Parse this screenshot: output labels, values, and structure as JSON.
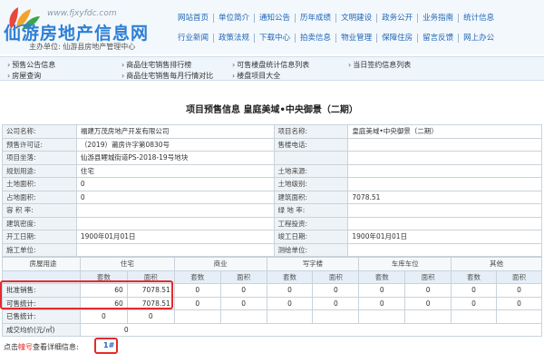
{
  "header": {
    "url": "www.fjxyfdc.com",
    "title": "仙游房地产信息网",
    "sponsor": "主办单位: 仙游县房地产管理中心"
  },
  "topnav": {
    "row1": [
      "网站首页",
      "单位简介",
      "通知公告",
      "历年成绩",
      "文明建设",
      "政务公开",
      "业务指南",
      "统计信息"
    ],
    "row2": [
      "行业新闻",
      "政策法规",
      "下载中心",
      "拍卖信息",
      "物业管理",
      "保障住房",
      "留言反馈",
      "网上办公"
    ]
  },
  "menubar": {
    "items": [
      "预售公告信息",
      "商品住宅销售排行榜",
      "可售楼盘统计信息列表",
      "当日签约信息列表",
      "房屋查询",
      "商品住宅销售每月行情对比",
      "楼盘项目大全"
    ]
  },
  "title": "项目预售信息 皇庭美域•中央御景（二期）",
  "info": {
    "rows": [
      [
        "公司名称:",
        "福建万茂房地产开发有限公司",
        "项目名称:",
        "皇庭美域•中央御景（二期）"
      ],
      [
        "预售许可证:",
        "（2019）莆房许字第0830号",
        "售楼电话:",
        ""
      ],
      [
        "项目坐落:",
        "仙游县鲤城街道PS-2018-19号地块",
        "",
        ""
      ],
      [
        "规划用途:",
        "住宅",
        "土地来源:",
        ""
      ],
      [
        "土地面积:",
        "0",
        "土地级别:",
        ""
      ],
      [
        "占地面积:",
        "0",
        "建筑面积:",
        "7078.51"
      ],
      [
        "容 积 率:",
        "",
        "绿 地 率:",
        ""
      ],
      [
        "建筑密度:",
        "",
        "工程投资:",
        ""
      ],
      [
        "开工日期:",
        "1900年01月01日",
        "竣工日期:",
        "1900年01月01日"
      ],
      [
        "施工单位:",
        "",
        "测绘单位:",
        ""
      ]
    ]
  },
  "stats": {
    "row_label_header": "房屋用途",
    "groups": [
      "住宅",
      "商业",
      "写字楼",
      "车库车位",
      "其他"
    ],
    "sub": [
      "套数",
      "面积"
    ],
    "rows": [
      {
        "label": "批准销售:",
        "values": [
          "60",
          "7078.51",
          "0",
          "0",
          "0",
          "0",
          "0",
          "0",
          "0",
          "0"
        ]
      },
      {
        "label": "可售统计:",
        "values": [
          "60",
          "7078.51",
          "0",
          "0",
          "0",
          "0",
          "0",
          "0",
          "0",
          "0"
        ]
      },
      {
        "label": "已售统计:",
        "values": [
          "0",
          "0",
          "",
          "",
          "",
          "",
          "",
          "",
          "",
          ""
        ]
      },
      {
        "label": "成交均价(元/㎡)",
        "values": [
          "0",
          "",
          "",
          "",
          "",
          "",
          "",
          "",
          "",
          ""
        ]
      }
    ]
  },
  "footer": {
    "prefix": "点击",
    "highlight": "幢号",
    "suffix": "查看详细信息:",
    "lot": "1#"
  },
  "colors": {
    "brand_blue": "#2d7fd6",
    "nav_link": "#1f66b8",
    "annotation_red": "#e52b2b"
  }
}
